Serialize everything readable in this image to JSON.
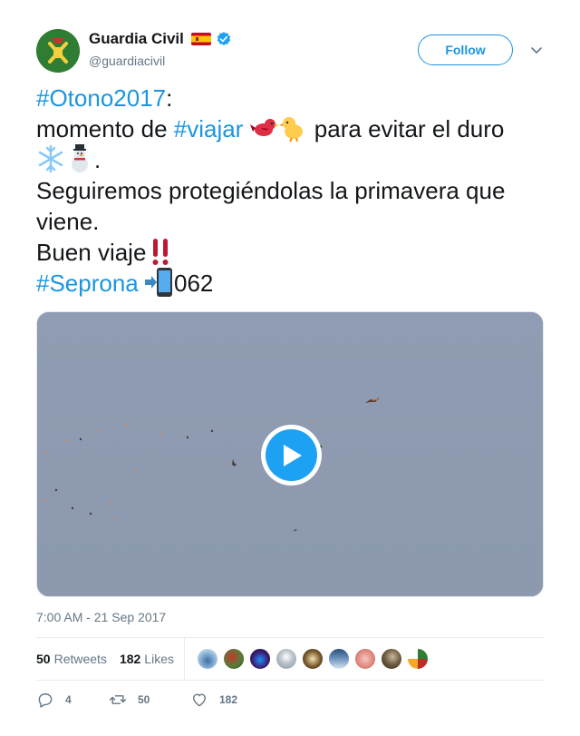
{
  "user": {
    "display_name": "Guardia Civil",
    "handle": "@guardiacivil",
    "verified": true,
    "flag": "spain-flag",
    "follow_label": "Follow"
  },
  "tweet": {
    "line1_hashtag": "#Otono2017",
    "line1_rest": ":",
    "line2_pre": "momento de ",
    "line2_hashtag": "#viajar",
    "line2_post": " para evitar el duro",
    "line3_post": ".",
    "line4": "Seguiremos protegiéndolas la primavera que viene.",
    "line5": "Buen viaje",
    "line6_hashtag": "#Seprona",
    "line6_post": "062",
    "emojis": [
      "bird-emoji",
      "chick-emoji",
      "snowflake-emoji",
      "snowman-emoji",
      "double-exclamation-emoji",
      "phone-arrow-emoji"
    ]
  },
  "media": {
    "type": "video",
    "icon": "play-icon"
  },
  "timestamp": "7:00 AM - 21 Sep 2017",
  "stats": {
    "retweets_count": "50",
    "retweets_label": "Retweets",
    "likes_count": "182",
    "likes_label": "Likes",
    "liker_avatars": 9
  },
  "actions": {
    "replies": "4",
    "retweets": "50",
    "likes": "182"
  },
  "colors": {
    "link": "#1b95e0",
    "text": "#14171a",
    "muted": "#657786",
    "play": "#1da1f2",
    "sky": "#8e9bb1"
  }
}
